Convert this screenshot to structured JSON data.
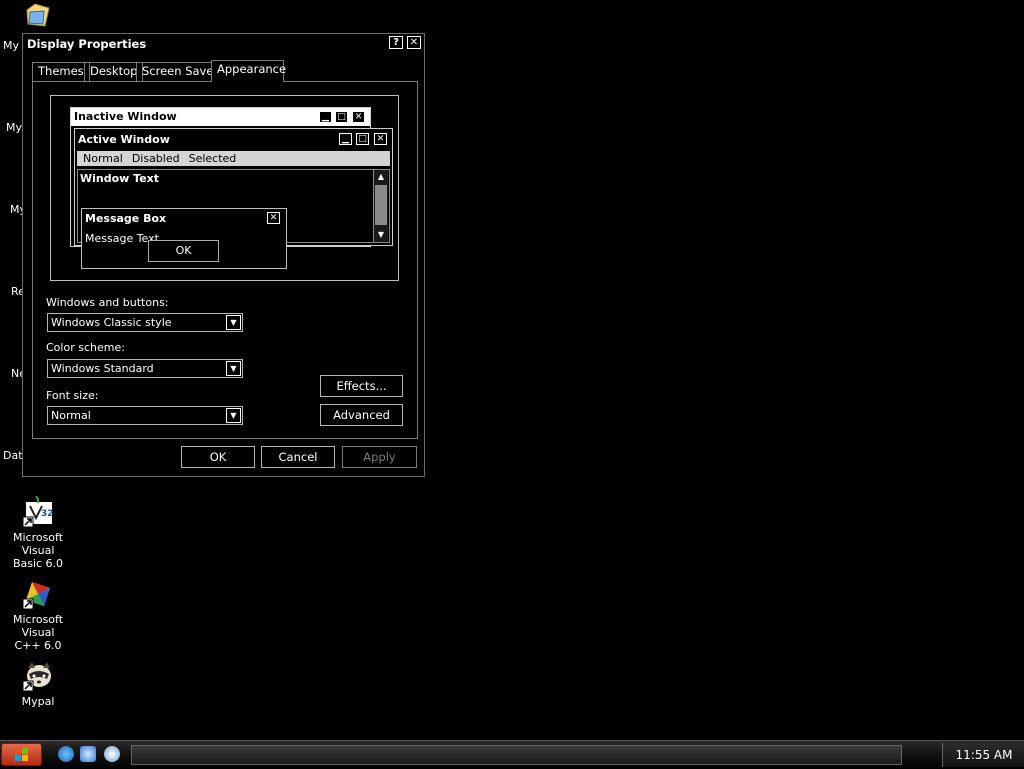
{
  "desktop": {
    "clipped_labels": [
      "My I",
      "My",
      "My",
      "Re",
      "Ne",
      "Data"
    ],
    "icons": [
      {
        "label_line1": "Microsoft Visual",
        "label_line2": "Basic 6.0"
      },
      {
        "label_line1": "Microsoft Visual",
        "label_line2": "C++ 6.0"
      },
      {
        "label_line1": "Mypal",
        "label_line2": ""
      }
    ]
  },
  "dialog": {
    "title": "Display Properties",
    "help_glyph": "?",
    "close_glyph": "✕",
    "tabs": [
      "Themes",
      "Desktop",
      "Screen Saver",
      "Appearance"
    ],
    "preview": {
      "inactive_title": "Inactive Window",
      "active_title": "Active Window",
      "menu": [
        "Normal",
        "Disabled",
        "Selected"
      ],
      "window_text": "Window Text",
      "message_box_title": "Message Box",
      "message_text": "Message Text",
      "ok": "OK",
      "min_glyph": "▁",
      "max_glyph": "□",
      "close_glyph": "✕",
      "up_glyph": "▲",
      "down_glyph": "▼"
    },
    "windows_buttons_label": "Windows and buttons:",
    "windows_buttons_value": "Windows Classic style",
    "color_scheme_label": "Color scheme:",
    "color_scheme_value": "Windows Standard",
    "font_size_label": "Font size:",
    "font_size_value": "Normal",
    "combo_arrow": "▼",
    "effects_button": "Effects...",
    "advanced_button": "Advanced",
    "ok_button": "OK",
    "cancel_button": "Cancel",
    "apply_button": "Apply"
  },
  "taskbar": {
    "clock": "11:55 AM"
  }
}
